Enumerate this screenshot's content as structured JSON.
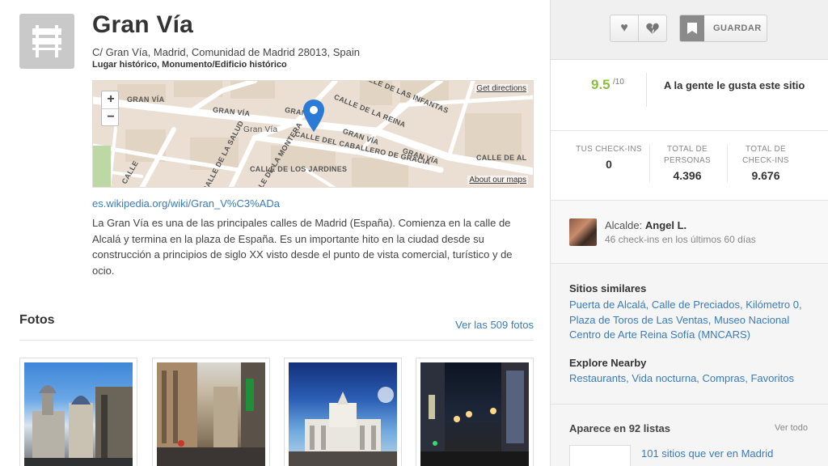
{
  "venue": {
    "title": "Gran Vía",
    "address": "C/ Gran Vía, Madrid, Comunidad de Madrid 28013, Spain",
    "categories": "Lugar histórico, Monumento/Edificio histórico",
    "icon": "landmark-sign-icon"
  },
  "map": {
    "zoom_in": "+",
    "zoom_out": "−",
    "directions": "Get directions",
    "about": "About our maps",
    "streets": {
      "gran_via_1": "GRAN VÍA",
      "gran_via_2": "GRAN VÍA",
      "gran_via_3": "Gran Vía",
      "gran_via_4": "GRAN VÍA",
      "gran_via_5": "GRAN VÍA",
      "gran_via_6": "GRAN",
      "infantas": "CALLE DE LAS INFANTAS",
      "reina": "CALLE DE LA REINA",
      "caballero": "CALLE DEL CABALLERO DE GRACIA",
      "jardines": "CALLE DE LOS JARDINES",
      "salud": "CALLE DE LA SALUD",
      "montera": "CALLE DE LA MONTERA",
      "calle_left": "CALLE",
      "calle_right": "CALLE DE AL"
    }
  },
  "wiki_link": "es.wikipedia.org/wiki/Gran_V%C3%ADa",
  "description": "La Gran Vía es una de las principales calles de Madrid (España). Comienza en la calle de Alcalá y termina en la plaza de España. Es un importante hito en la ciudad desde su construcción a principios de siglo XX visto desde el punto de vista comercial, turístico y de ocio.",
  "photos": {
    "title": "Fotos",
    "see_all": "Ver las 509 fotos"
  },
  "actions": {
    "like_icon": "heart-icon",
    "dislike_icon": "broken-heart-icon",
    "save_label": "GUARDAR"
  },
  "rating": {
    "score": "9.5",
    "denominator": "/10",
    "text": "A la gente le gusta este sitio",
    "color": "#8bbf3c"
  },
  "stats": [
    {
      "label": "TUS CHECK-INS",
      "value": "0"
    },
    {
      "label": "TOTAL DE PERSONAS",
      "value": "4.396"
    },
    {
      "label": "TOTAL DE CHECK-INS",
      "value": "9.676"
    }
  ],
  "mayor": {
    "prefix": "Alcalde:",
    "name": "Angel L.",
    "subtitle": "46 check-ins en los últimos 60 días"
  },
  "similar": {
    "title": "Sitios similares",
    "links": "Puerta de Alcalá, Calle de Preciados, Kilómetro 0, Plaza de Toros de Las Ventas, Museo Nacional Centro de Arte Reina Sofía (MNCARS)"
  },
  "nearby": {
    "title": "Explore Nearby",
    "links": "Restaurants, Vida nocturna, Compras, Favoritos"
  },
  "lists": {
    "title": "Aparece en 92 listas",
    "see_all": "Ver todo",
    "first_item": "101 sitios que ver en Madrid"
  },
  "colors": {
    "link": "#3a7bbd",
    "score_green": "#8bbf3c",
    "map_pin": "#2a7ad6"
  }
}
